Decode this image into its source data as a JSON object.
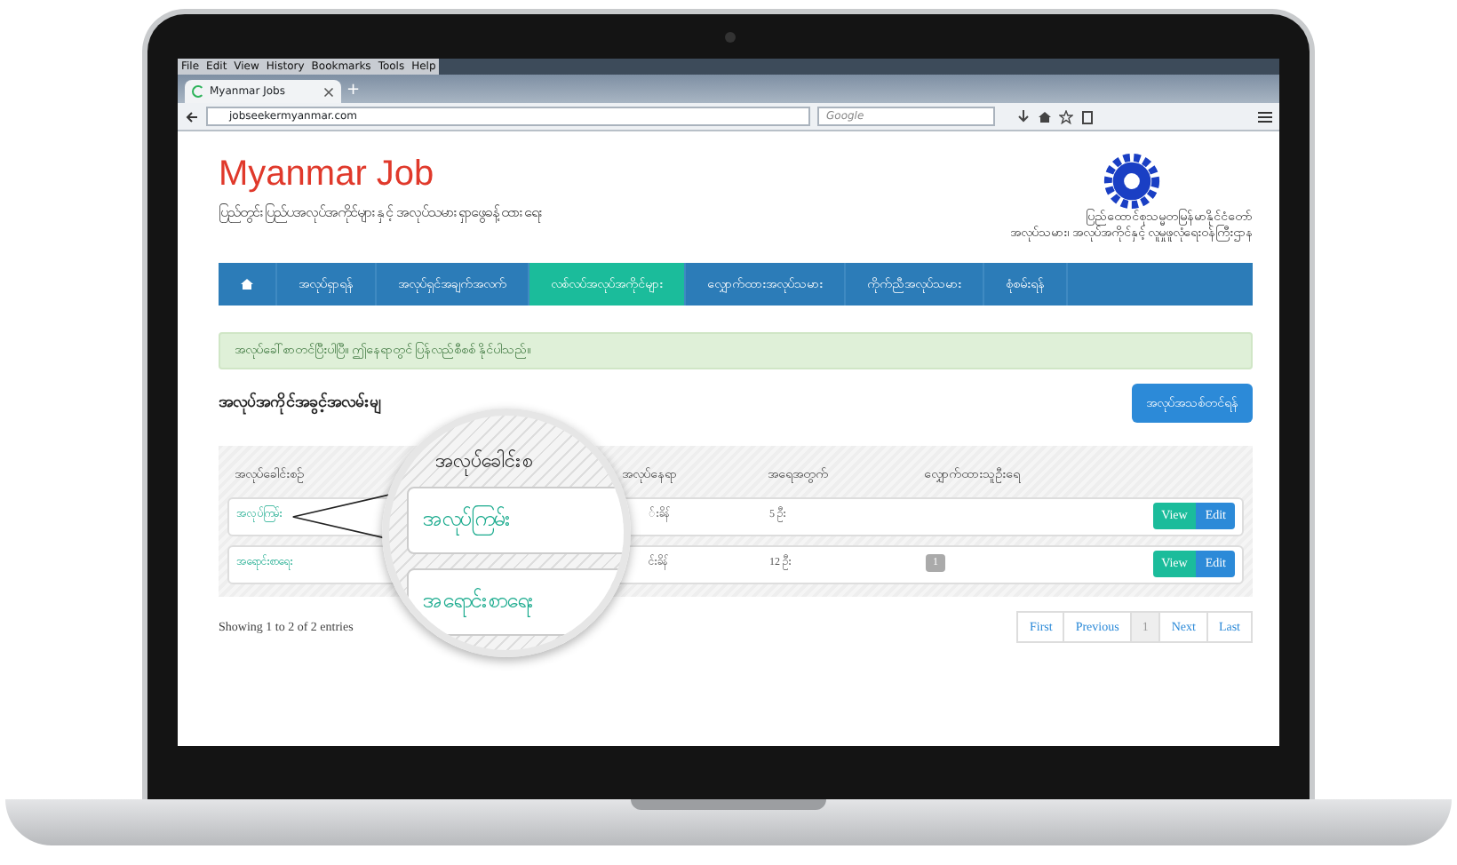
{
  "browser": {
    "menu": [
      "File",
      "Edit",
      "View",
      "History",
      "Bookmarks",
      "Tools",
      "Help"
    ],
    "tab_title": "Myanmar Jobs",
    "new_tab": "+",
    "address": "jobseekermyanmar.com",
    "search_placeholder": "Google"
  },
  "site": {
    "title": "Myanmar Job",
    "tagline": "ပြည်တွင်းပြည်ပအလုပ်အကိုင်များနှင့် အလုပ်သမားရှာဖွေခန့်ထားရေး",
    "org_caption": [
      "ပြည်ထောင်စုသမ္မတမြန်မာနိုင်ငံတော်",
      "အလုပ်သမား၊ အလုပ်အကိုင်နှင့် လူမှုဖူလုံရေးဝန်ကြီးဌာန"
    ]
  },
  "nav": [
    {
      "kind": "icon",
      "selected": false
    },
    {
      "kind": "text",
      "label": "အလုပ်ရှာရန်",
      "selected": false
    },
    {
      "kind": "text",
      "label": "အလုပ်ရှင်အချက်အလက်",
      "selected": false
    },
    {
      "kind": "text",
      "label": "လစ်လပ်အလုပ်အကိုင်များ",
      "selected": true
    },
    {
      "kind": "text",
      "label": "လျှောက်ထားအလုပ်သမား",
      "selected": false
    },
    {
      "kind": "text",
      "label": "ကိုက်ညီအလုပ်သမား",
      "selected": false
    },
    {
      "kind": "text",
      "label": "စုံစမ်းရန်",
      "selected": false
    }
  ],
  "alert": "အလုပ်ခေါ်စာတင်ပြီးပါပြီ။ ဤနေရာတွင် ပြန်လည်စီစစ် နိုင်ပါသည်။",
  "heading": "အလုပ်အကိုင်အခွင့်အလမ်းမျ",
  "post_button": "အလုပ်အသစ်တင်ရန်",
  "table": {
    "columns": [
      "အလုပ်ခေါင်းစဉ်",
      "အလုပ်နေရာ",
      "အရေအတွက်",
      "လျှောက်ထားသူဦးရေ"
    ],
    "rows": [
      {
        "title": "အလုပ်ကြမ်း",
        "location": "်းခိန်",
        "count": "5 ဦး",
        "applicants": null,
        "actions": [
          "View",
          "Edit"
        ]
      },
      {
        "title": "အရောင်းစာရေး",
        "location": "င်းခိန်",
        "count": "12 ဦး",
        "applicants": "1",
        "actions": [
          "View",
          "Edit"
        ]
      }
    ]
  },
  "magnifier": {
    "heading": "အလုပ်ခေါင်းစ",
    "items": [
      "အလုပ်ကြမ်း",
      "အရောင်းစာရေး"
    ]
  },
  "entries_info": "Showing 1 to 2 of 2 entries",
  "pagination": [
    {
      "label": "First",
      "selected": false
    },
    {
      "label": "Previous",
      "selected": false
    },
    {
      "label": "1",
      "selected": true
    },
    {
      "label": "Next",
      "selected": false
    },
    {
      "label": "Last",
      "selected": false
    }
  ]
}
